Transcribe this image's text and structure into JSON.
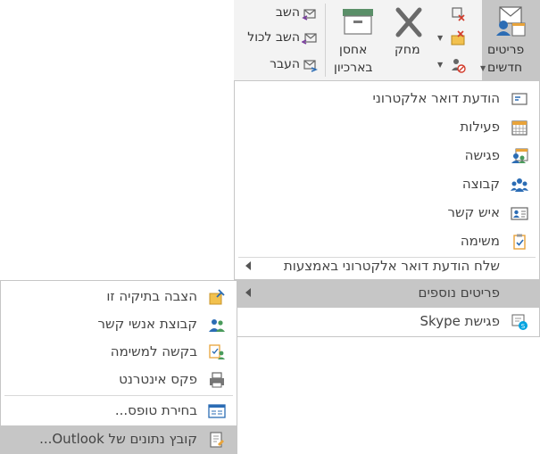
{
  "ribbon": {
    "reply": "השב",
    "reply_all": "השב לכול",
    "forward": "העבר",
    "archive_line1": "אחסן",
    "archive_line2": "בארכיון",
    "delete": "מחק",
    "new_items_line1": "פריטים",
    "new_items_line2": "חדשים"
  },
  "new_items_menu": {
    "items": [
      {
        "label": "הודעת דואר אלקטרוני",
        "icon": "email-icon"
      },
      {
        "label": "פעילות",
        "icon": "calendar-icon"
      },
      {
        "label": "פגישה",
        "icon": "meeting-icon"
      },
      {
        "label": "קבוצה",
        "icon": "group-icon"
      },
      {
        "label": "איש קשר",
        "icon": "contact-card-icon"
      },
      {
        "label": "משימה",
        "icon": "task-clipboard-icon"
      }
    ],
    "send_using": "שלח הודעת דואר אלקטרוני באמצעות",
    "more_items": "פריטים נוספים",
    "skype_meeting": "פגישת Skype"
  },
  "more_items_submenu": {
    "items": [
      {
        "label": "הצבה בתיקיה זו",
        "icon": "post-pin-icon"
      },
      {
        "label": "קבוצת אנשי קשר",
        "icon": "contact-group-icon"
      },
      {
        "label": "בקשה למשימה",
        "icon": "task-request-icon"
      },
      {
        "label": "פקס אינטרנט",
        "icon": "fax-icon"
      },
      {
        "label": "בחירת טופס...",
        "icon": "form-icon"
      },
      {
        "label": "קובץ נתונים של Outlook...",
        "icon": "data-file-icon"
      }
    ]
  },
  "colors": {
    "highlight": "#c6c6c6",
    "accent_blue": "#2b6cb4",
    "accent_orange": "#e8a33a"
  }
}
